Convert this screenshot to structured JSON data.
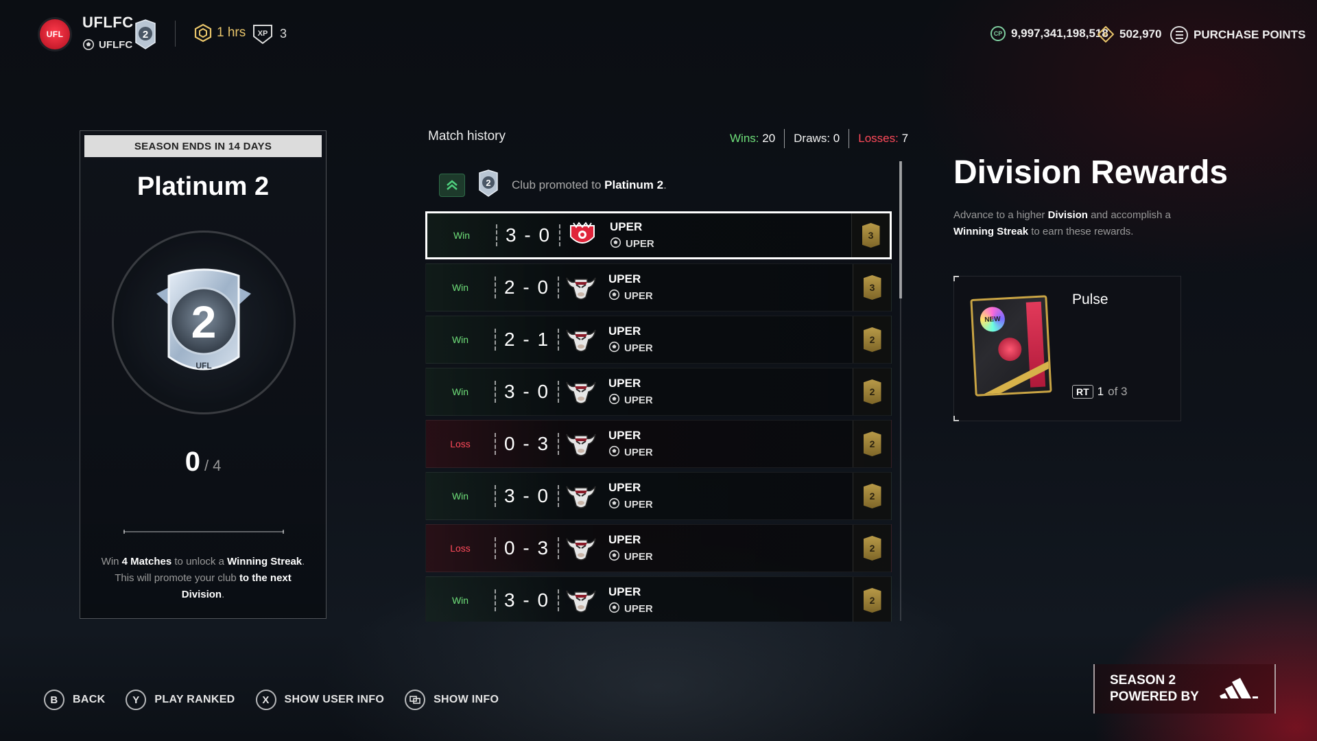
{
  "header": {
    "club_logo_text": "UFL",
    "club_name": "UFLFC",
    "club_tag": "UFLFC",
    "rank_level": "2",
    "hours": "1 hrs",
    "xp_level": "3",
    "coins": "9,997,341,198,518",
    "coins_icon_text": "CP",
    "points": "502,970",
    "purchase_label": "PURCHASE POINTS"
  },
  "season": {
    "ends_label": "SEASON ENDS IN 14 DAYS",
    "division": "Platinum 2",
    "badge_number": "2",
    "badge_logo": "UFL",
    "progress_current": "0",
    "progress_sep": "/",
    "progress_max": "4",
    "streak_text_1": "Win ",
    "streak_bold_1": "4 Matches",
    "streak_text_2": " to unlock a ",
    "streak_bold_2": "Winning Streak",
    "streak_text_3": ". This will promote your club ",
    "streak_bold_3": "to the next",
    "streak_bold_4": "Division",
    "streak_text_4": "."
  },
  "match_history": {
    "title": "Match history",
    "wins_label": "Wins:",
    "wins": "20",
    "draws_label": "Draws:",
    "draws": "0",
    "losses_label": "Losses:",
    "losses": "7",
    "promo_text": "Club promoted to ",
    "promo_division": "Platinum 2",
    "promo_period": ".",
    "promo_badge": "2",
    "matches": [
      {
        "result": "Win",
        "score": "3 - 0",
        "opponent": "UPER",
        "tag": "UPER",
        "tier": "3",
        "crest": "red"
      },
      {
        "result": "Win",
        "score": "2 - 0",
        "opponent": "UPER",
        "tag": "UPER",
        "tier": "3",
        "crest": "bull"
      },
      {
        "result": "Win",
        "score": "2 - 1",
        "opponent": "UPER",
        "tag": "UPER",
        "tier": "2",
        "crest": "bull"
      },
      {
        "result": "Win",
        "score": "3 - 0",
        "opponent": "UPER",
        "tag": "UPER",
        "tier": "2",
        "crest": "bull"
      },
      {
        "result": "Loss",
        "score": "0 - 3",
        "opponent": "UPER",
        "tag": "UPER",
        "tier": "2",
        "crest": "bull"
      },
      {
        "result": "Win",
        "score": "3 - 0",
        "opponent": "UPER",
        "tag": "UPER",
        "tier": "2",
        "crest": "bull"
      },
      {
        "result": "Loss",
        "score": "0 - 3",
        "opponent": "UPER",
        "tag": "UPER",
        "tier": "2",
        "crest": "bull"
      },
      {
        "result": "Win",
        "score": "3 - 0",
        "opponent": "UPER",
        "tag": "UPER",
        "tier": "2",
        "crest": "bull"
      }
    ]
  },
  "rewards": {
    "title": "Division Rewards",
    "desc_1": "Advance to a higher ",
    "desc_b1": "Division",
    "desc_2": " and accomplish a ",
    "desc_b2": "Winning Streak",
    "desc_3": " to earn these rewards.",
    "pack_new": "NEW",
    "reward_name": "Pulse",
    "rt_key": "RT",
    "count": "1",
    "count_of": "of 3"
  },
  "controls": [
    {
      "key": "B",
      "label": "BACK"
    },
    {
      "key": "Y",
      "label": "PLAY RANKED"
    },
    {
      "key": "X",
      "label": "SHOW USER INFO"
    },
    {
      "key": "",
      "label": "SHOW INFO"
    }
  ],
  "sponsor": {
    "line1": "SEASON 2",
    "line2": "POWERED BY"
  },
  "colors": {
    "win": "#6fe07a",
    "loss": "#ff4a5a",
    "gold": "#c9a444"
  }
}
